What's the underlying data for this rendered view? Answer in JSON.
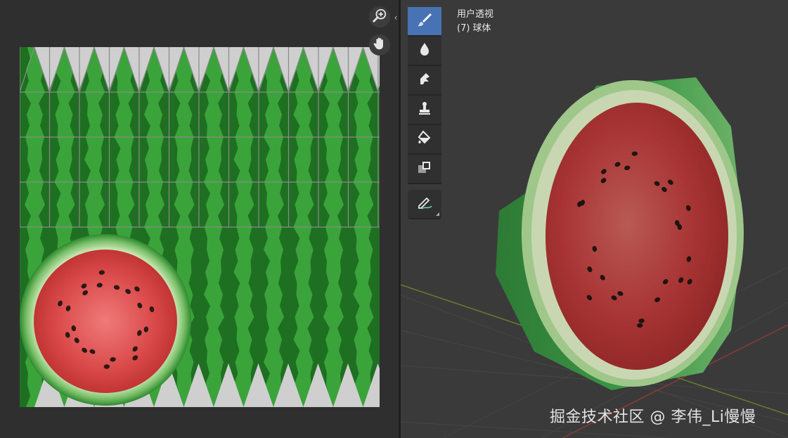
{
  "app": "Blender",
  "uv_editor": {
    "zoom_icon": "zoom-in-icon",
    "pan_icon": "hand-icon",
    "collapse_glyph": "‹"
  },
  "viewport": {
    "view_label": "用户透视",
    "object_label": "(7) 球体"
  },
  "tools": [
    {
      "name": "draw",
      "icon": "brush-icon",
      "active": true
    },
    {
      "name": "soften",
      "icon": "drop-icon",
      "active": false
    },
    {
      "name": "smear",
      "icon": "smear-icon",
      "active": false
    },
    {
      "name": "clone",
      "icon": "stamp-icon",
      "active": false
    },
    {
      "name": "fill",
      "icon": "bucket-icon",
      "active": false
    },
    {
      "name": "mask",
      "icon": "mask-icon",
      "active": false
    },
    {
      "name": "annotate",
      "icon": "annotate-pen-icon",
      "active": false
    }
  ],
  "watermark": "掘金技术社区 @ 李伟_Li慢慢",
  "colors": {
    "active_tool": "#4772b3",
    "rind_dark": "#1f6b1f",
    "rind_light": "#3fae3f",
    "flesh": "#c23a3a",
    "seed": "#2a1a14"
  }
}
